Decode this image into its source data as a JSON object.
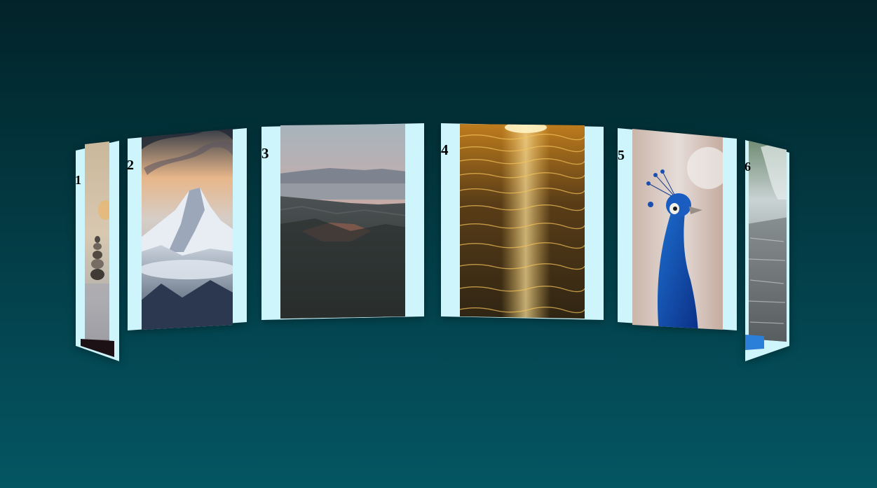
{
  "background": {
    "top_color": "#022329",
    "bottom_color": "#045663"
  },
  "frame_color": "#cdf5fb",
  "cards": [
    {
      "number": "1",
      "photo": "zen-stones-photo"
    },
    {
      "number": "2",
      "photo": "snowy-mountain-photo"
    },
    {
      "number": "3",
      "photo": "mountain-valley-photo"
    },
    {
      "number": "4",
      "photo": "sunset-water-photo"
    },
    {
      "number": "5",
      "photo": "peacock-photo"
    },
    {
      "number": "6",
      "photo": "waterfall-photo"
    }
  ]
}
